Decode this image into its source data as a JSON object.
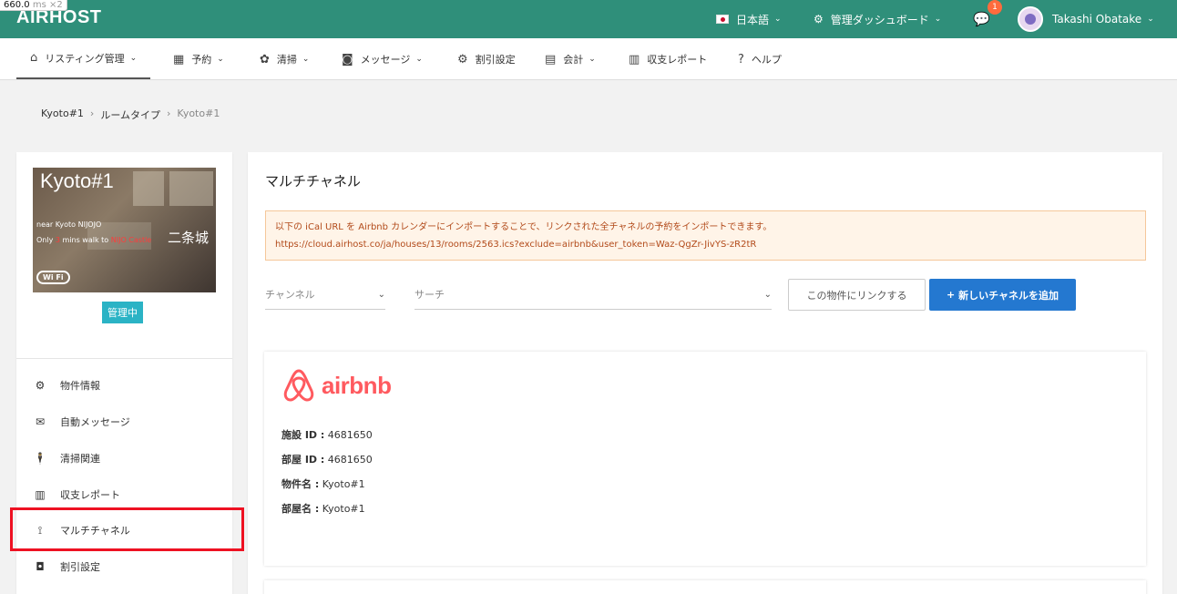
{
  "timing": {
    "value": "660.0",
    "unit": "ms",
    "multiplier": "×2"
  },
  "header": {
    "logo": "AIRHOST",
    "language": "日本語",
    "dashboard": "管理ダッシュボード",
    "notification_count": "1",
    "user_name": "Takashi Obatake"
  },
  "nav": {
    "listing": "リスティング管理",
    "reservations": "予約",
    "cleaning": "清掃",
    "messages": "メッセージ",
    "discounts": "割引設定",
    "accounting": "会計",
    "report": "収支レポート",
    "help": "ヘルプ"
  },
  "breadcrumb": [
    "Kyoto#1",
    "ルームタイプ",
    "Kyoto#1"
  ],
  "property": {
    "title": "Kyoto#1",
    "line1": "near Kyoto NIJOJO",
    "line2_prefix": "Only ",
    "line2_num": "3",
    "line2_mid": " mins walk to ",
    "line2_hl": "NIJO Castle",
    "kanji": "二条城",
    "wifi": "Wi Fi",
    "status": "管理中"
  },
  "sidebar": {
    "items": [
      {
        "label": "物件情報",
        "icon": "gear-icon"
      },
      {
        "label": "自動メッセージ",
        "icon": "envelope-icon"
      },
      {
        "label": "清掃関連",
        "icon": "person-icon"
      },
      {
        "label": "収支レポート",
        "icon": "report-icon"
      },
      {
        "label": "マルチチャネル",
        "icon": "channels-icon"
      },
      {
        "label": "割引設定",
        "icon": "tag-icon"
      }
    ]
  },
  "main": {
    "title": "マルチチャネル",
    "alert_line1": "以下の iCal URL を Airbnb カレンダーにインポートすることで、リンクされた全チャネルの予約をインポートできます。",
    "alert_line2": "https://cloud.airhost.co/ja/houses/13/rooms/2563.ics?exclude=airbnb&user_token=Waz-QgZr-JivYS-zR2tR",
    "channel_placeholder": "チャンネル",
    "search_placeholder": "サーチ",
    "link_button": "この物件にリンクする",
    "add_button": "新しいチャネルを追加"
  },
  "card": {
    "brand": "airbnb",
    "facility_id_label": "施設 ID :",
    "facility_id": "4681650",
    "room_id_label": "部屋 ID :",
    "room_id": "4681650",
    "property_name_label": "物件名 :",
    "property_name": "Kyoto#1",
    "room_name_label": "部屋名 :",
    "room_name": "Kyoto#1"
  },
  "colors": {
    "header": "#2f8f7a",
    "primary": "#2478d0",
    "airbnb": "#ff5a5f",
    "highlight": "#ee1122",
    "status": "#2bb3c5"
  }
}
